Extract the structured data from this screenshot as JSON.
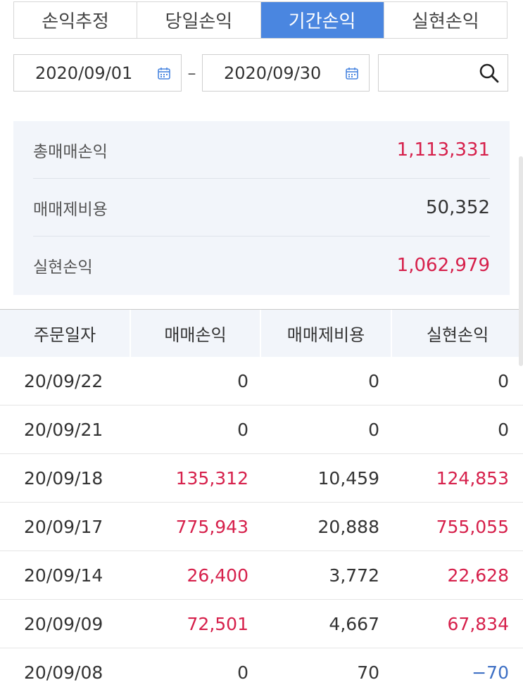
{
  "tabs": [
    {
      "label": "손익추정",
      "active": false
    },
    {
      "label": "당일손익",
      "active": false
    },
    {
      "label": "기간손익",
      "active": true
    },
    {
      "label": "실현손익",
      "active": false
    }
  ],
  "date_range": {
    "start": "2020/09/01",
    "separator": "–",
    "end": "2020/09/30"
  },
  "search": {
    "value": "",
    "placeholder": ""
  },
  "summary": {
    "total_trade_pl": {
      "label": "총매매손익",
      "value": "1,113,331"
    },
    "trade_costs": {
      "label": "매매제비용",
      "value": "50,352"
    },
    "realized_pl": {
      "label": "실현손익",
      "value": "1,062,979"
    }
  },
  "table": {
    "headers": [
      "주문일자",
      "매매손익",
      "매매제비용",
      "실현손익"
    ],
    "rows": [
      {
        "date": "20/09/22",
        "trade_pl": "0",
        "costs": "0",
        "realized": "0",
        "trade_color": "normal",
        "realized_color": "normal"
      },
      {
        "date": "20/09/21",
        "trade_pl": "0",
        "costs": "0",
        "realized": "0",
        "trade_color": "normal",
        "realized_color": "normal"
      },
      {
        "date": "20/09/18",
        "trade_pl": "135,312",
        "costs": "10,459",
        "realized": "124,853",
        "trade_color": "red",
        "realized_color": "red"
      },
      {
        "date": "20/09/17",
        "trade_pl": "775,943",
        "costs": "20,888",
        "realized": "755,055",
        "trade_color": "red",
        "realized_color": "red"
      },
      {
        "date": "20/09/14",
        "trade_pl": "26,400",
        "costs": "3,772",
        "realized": "22,628",
        "trade_color": "red",
        "realized_color": "red"
      },
      {
        "date": "20/09/09",
        "trade_pl": "72,501",
        "costs": "4,667",
        "realized": "67,834",
        "trade_color": "red",
        "realized_color": "red"
      },
      {
        "date": "20/09/08",
        "trade_pl": "0",
        "costs": "70",
        "realized": "−70",
        "trade_color": "normal",
        "realized_color": "blue"
      }
    ]
  },
  "colors": {
    "accent": "#4a86e0",
    "profit": "#d6204b",
    "loss": "#3d6fc4",
    "panel_bg": "#f2f5fa"
  },
  "icons": {
    "calendar": "calendar-icon",
    "search": "search-icon"
  }
}
